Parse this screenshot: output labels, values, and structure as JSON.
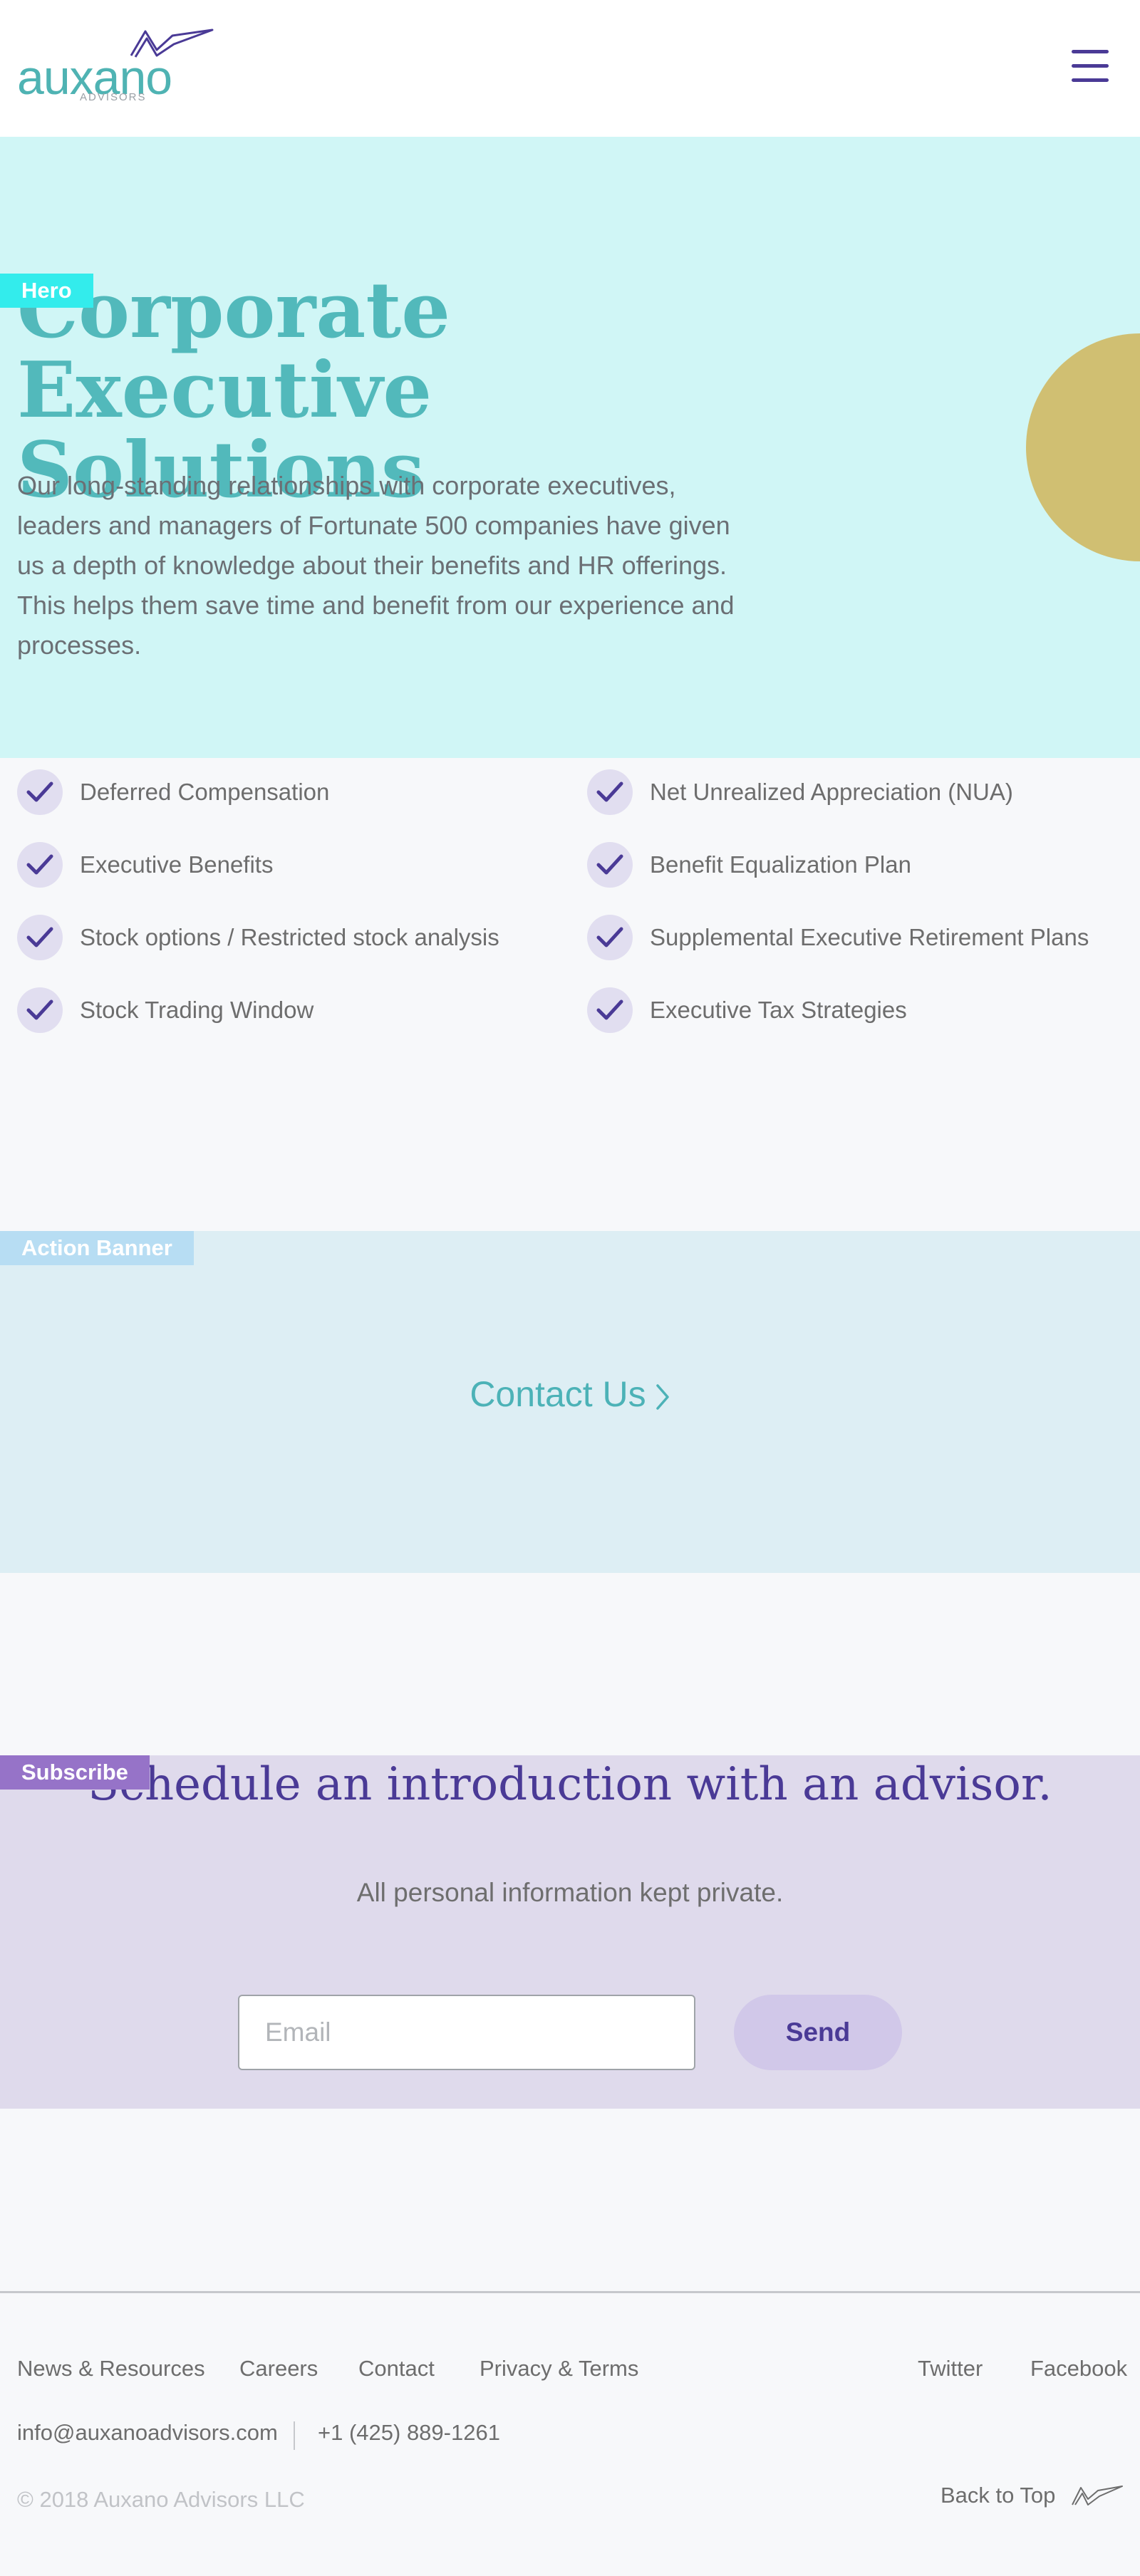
{
  "brand": {
    "name": "auxano",
    "subtitle": "ADVISORS",
    "colors": {
      "teal": "#52b9bb",
      "purple": "#4a3a96",
      "gold": "#d0bf72"
    }
  },
  "header": {
    "menu_icon": "hamburger-menu-icon"
  },
  "hero": {
    "tag": "Hero",
    "title": "Corporate Executive Solutions",
    "text": "Our long-standing relationships with corporate executives, leaders and managers of Fortunate 500 companies have given us a depth of knowledge about their benefits and HR offerings. This helps them save time and benefit from our experience and processes."
  },
  "features": [
    "Deferred Compensation",
    "Net Unrealized Appreciation (NUA)",
    "Executive Benefits",
    "Benefit Equalization Plan",
    "Stock options / Restricted stock analysis",
    "Supplemental Executive Retirement Plans",
    "Stock Trading Window",
    "Executive Tax Strategies"
  ],
  "action_banner": {
    "tag": "Action Banner",
    "link": "Contact Us"
  },
  "subscribe": {
    "tag": "Subscribe",
    "title": "Schedule an introduction with an advisor.",
    "note": "All personal information kept private.",
    "email_placeholder": "Email",
    "send_label": "Send"
  },
  "footer": {
    "links": [
      "News & Resources",
      "Careers",
      "Contact",
      "Privacy & Terms"
    ],
    "social": [
      "Twitter",
      "Facebook"
    ],
    "email": "info@auxanoadvisors.com",
    "phone": "+1 (425) 889-1261",
    "copyright": "© 2018 Auxano Advisors LLC",
    "back_to_top": "Back to Top"
  }
}
